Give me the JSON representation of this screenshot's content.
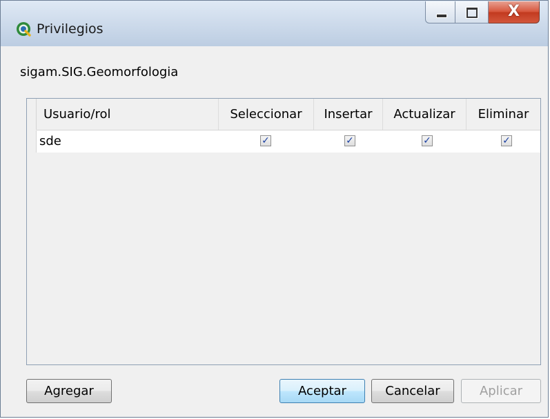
{
  "window": {
    "title": "Privilegios",
    "icon": "qgis-logo-icon",
    "caption_buttons": {
      "minimize": "minimize-icon",
      "maximize": "maximize-icon",
      "close": "close-icon"
    },
    "close_glyph": "X"
  },
  "object_name": "sigam.SIG.Geomorfologia",
  "grid": {
    "columns": [
      "Usuario/rol",
      "Seleccionar",
      "Insertar",
      "Actualizar",
      "Eliminar"
    ],
    "rows": [
      {
        "user": "sde",
        "seleccionar": true,
        "insertar": true,
        "actualizar": true,
        "eliminar": true
      }
    ],
    "check_glyph": "✓"
  },
  "buttons": {
    "add": "Agregar",
    "ok": "Aceptar",
    "cancel": "Cancelar",
    "apply": "Aplicar"
  },
  "colors": {
    "title_bar": "#cfdcec",
    "close_button": "#c23a1f",
    "default_button_border": "#3c7fb1",
    "check_mark": "#1a3fa0"
  }
}
